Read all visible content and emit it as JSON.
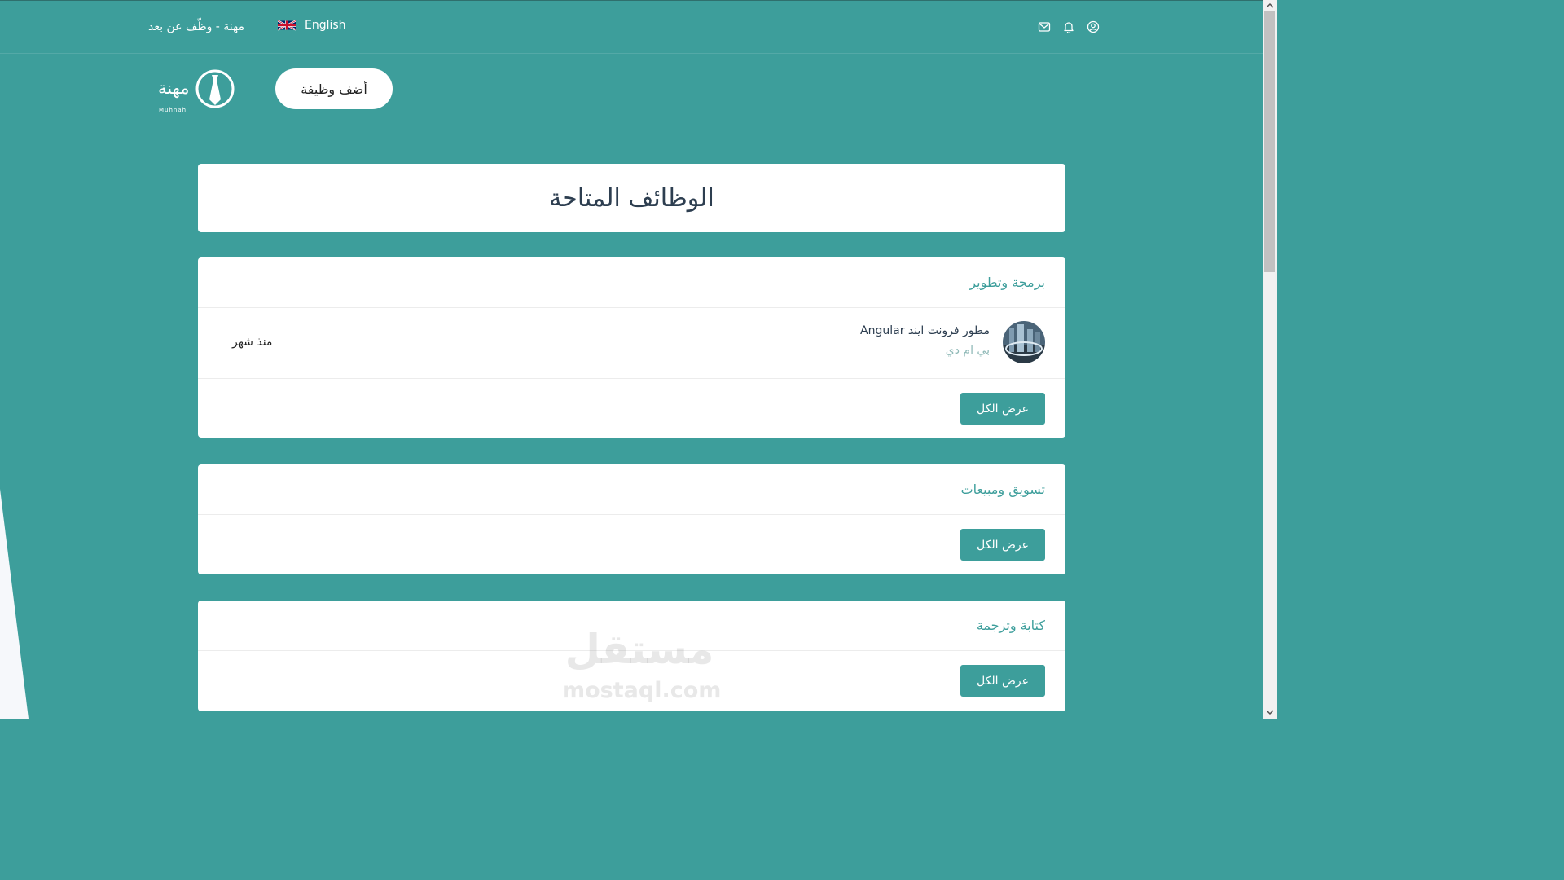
{
  "topbar": {
    "tagline": "مهنة - وظّف عن بعد",
    "language": "English",
    "icons": [
      "mail-icon",
      "bell-icon",
      "user-icon"
    ]
  },
  "header": {
    "logo_text": "مهنة",
    "logo_sub": "Muhnah",
    "add_job_label": "أضف وظيفة"
  },
  "page_title": "الوظائف المتاحة",
  "categories": [
    {
      "title": "برمجة وتطوير",
      "jobs": [
        {
          "title": "مطور فرونت ايند Angular",
          "company": "بي ام دي",
          "time": "منذ شهر"
        }
      ],
      "view_all": "عرض الكل"
    },
    {
      "title": "تسويق ومبيعات",
      "jobs": [],
      "view_all": "عرض الكل"
    },
    {
      "title": "كتابة وترجمة",
      "jobs": [],
      "view_all": "عرض الكل"
    }
  ],
  "watermark": {
    "arabic": "مستقل",
    "latin": "mostaql.com"
  },
  "colors": {
    "primary": "#3d9e9b",
    "white": "#ffffff",
    "heading": "#2d3e50",
    "muted": "#8fb9b7"
  }
}
